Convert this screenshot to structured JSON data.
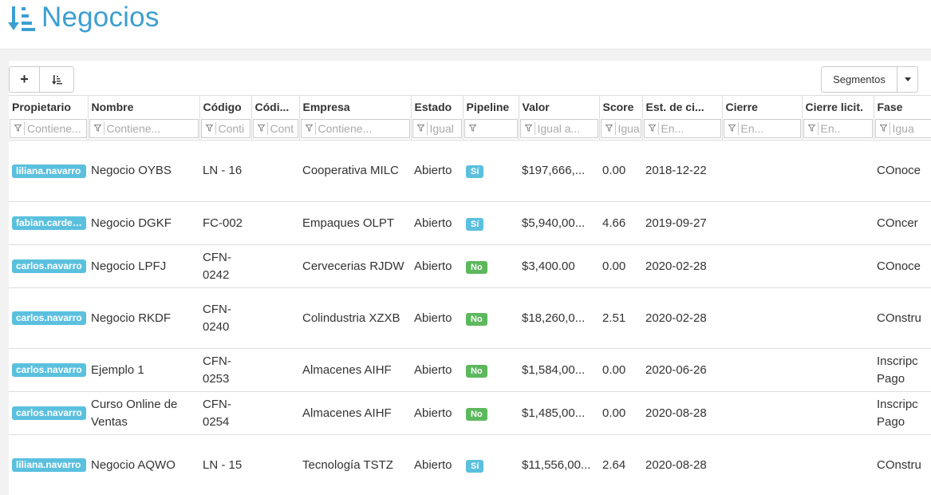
{
  "page": {
    "title": "Negocios"
  },
  "toolbar": {
    "add_label": "+",
    "segments_label": "Segmentos"
  },
  "columns": [
    {
      "label": "Propietario",
      "filter": "Contiene..."
    },
    {
      "label": "Nombre",
      "filter": "Contiene..."
    },
    {
      "label": "Código",
      "filter": "Conti"
    },
    {
      "label": "Códi...",
      "filter": "Cont"
    },
    {
      "label": "Empresa",
      "filter": "Contiene..."
    },
    {
      "label": "Estado",
      "filter": "Igual"
    },
    {
      "label": "Pipeline",
      "filter": ""
    },
    {
      "label": "Valor",
      "filter": "Igual a..."
    },
    {
      "label": "Score",
      "filter": "Igua"
    },
    {
      "label": "Est. de ci...",
      "filter": "En..."
    },
    {
      "label": "Cierre",
      "filter": "En..."
    },
    {
      "label": "Cierre licit.",
      "filter": "En.."
    },
    {
      "label": "Fase",
      "filter": "Igua"
    }
  ],
  "rows": [
    {
      "owner": "liliana.navarro",
      "name": "Negocio OYBS",
      "code": "LN - 16",
      "company": "Cooperativa MILC",
      "status": "Abierto",
      "pipeline": "Sí",
      "value": "$197,666,...",
      "score": "0.00",
      "est_close": "2018-12-22",
      "phase": "COnoce"
    },
    {
      "owner": "fabian.cardenas",
      "name": "Negocio DGKF",
      "code": "FC-002",
      "company": "Empaques OLPT",
      "status": "Abierto",
      "pipeline": "Sí",
      "value": "$5,940,00...",
      "score": "4.66",
      "est_close": "2019-09-27",
      "phase": "COncer"
    },
    {
      "owner": "carlos.navarro",
      "name": "Negocio LPFJ",
      "code": "CFN-0242",
      "company": "Cervecerias RJDW",
      "status": "Abierto",
      "pipeline": "No",
      "value": "$3,400.00",
      "score": "0.00",
      "est_close": "2020-02-28",
      "phase": "COnoce"
    },
    {
      "owner": "carlos.navarro",
      "name": "Negocio RKDF",
      "code": "CFN-0240",
      "company": "Colindustria XZXB",
      "status": "Abierto",
      "pipeline": "No",
      "value": "$18,260,0...",
      "score": "2.51",
      "est_close": "2020-02-28",
      "phase": "COnstru"
    },
    {
      "owner": "carlos.navarro",
      "name": "Ejemplo 1",
      "code": "CFN-0253",
      "company": "Almacenes AIHF",
      "status": "Abierto",
      "pipeline": "No",
      "value": "$1,584,00...",
      "score": "0.00",
      "est_close": "2020-06-26",
      "phase": "Inscripc Pago"
    },
    {
      "owner": "carlos.navarro",
      "name": "Curso Online de Ventas",
      "code": "CFN-0254",
      "company": "Almacenes AIHF",
      "status": "Abierto",
      "pipeline": "No",
      "value": "$1,485,00...",
      "score": "0.00",
      "est_close": "2020-08-28",
      "phase": "Inscripc Pago"
    },
    {
      "owner": "liliana.navarro",
      "name": "Negocio AQWO",
      "code": "LN - 15",
      "company": "Tecnología TSTZ",
      "status": "Abierto",
      "pipeline": "Sí",
      "value": "$11,556,00...",
      "score": "2.64",
      "est_close": "2020-08-28",
      "phase": "COnstru"
    }
  ],
  "colors": {
    "accent": "#3c9fd0",
    "link": "#3c8dbc",
    "badge_si": "#5bc0de",
    "badge_no": "#5cb85c"
  },
  "icons": {
    "title": "sort-amount-icon",
    "add": "plus-icon",
    "sort": "sort-icon",
    "filter": "funnel-icon",
    "caret": "caret-down-icon"
  }
}
